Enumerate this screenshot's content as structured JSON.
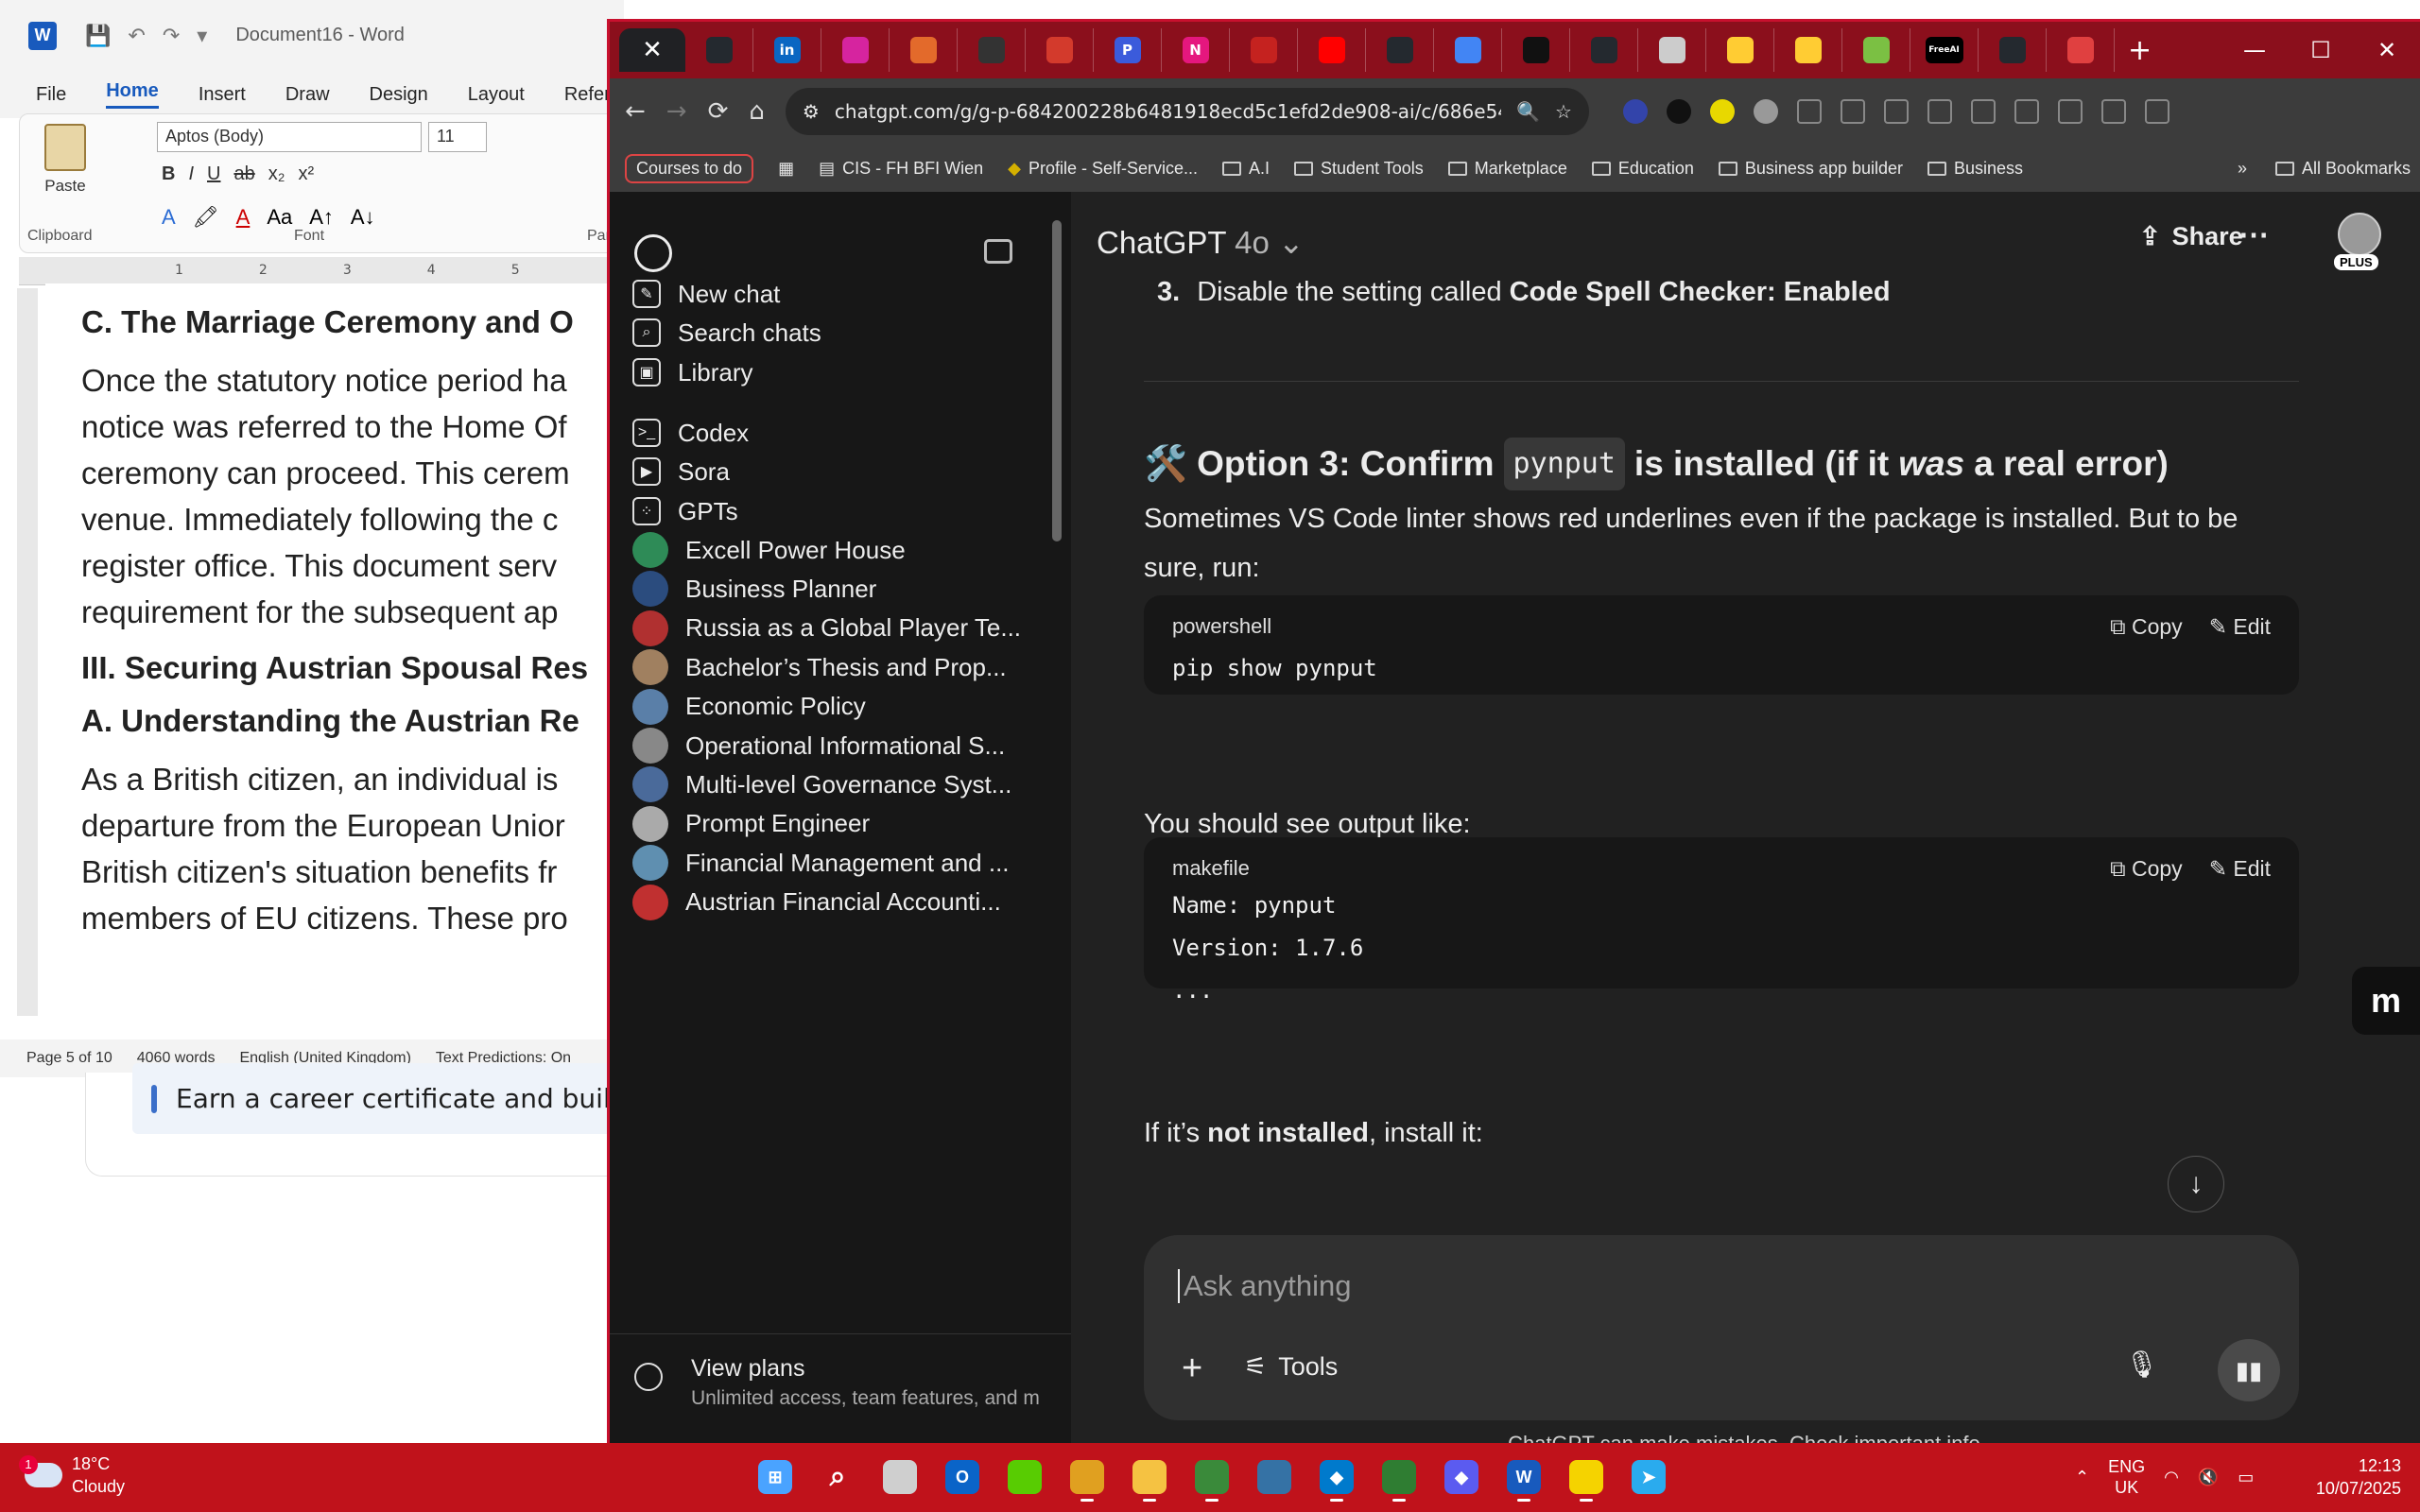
{
  "word": {
    "title": "Document16 - Word",
    "app_logo": "W",
    "quick_access": [
      "💾",
      "↶",
      "↷",
      "▾"
    ],
    "menu": [
      "File",
      "Home",
      "Insert",
      "Draw",
      "Design",
      "Layout",
      "References"
    ],
    "active_menu": "Home",
    "ribbon": {
      "paste_label": "Paste",
      "font_name": "Aptos (Body)",
      "font_size": "11",
      "format_buttons": [
        "B",
        "I",
        "U",
        "ab",
        "x₂",
        "x²"
      ],
      "format_buttons_2": [
        "A",
        "🖍",
        "A",
        "Aa",
        "A↑",
        "A↓"
      ],
      "clipboard_label": "Clipboard",
      "font_label": "Font",
      "paragraph_label": "Parag"
    },
    "ruler_marks": [
      "1",
      "2",
      "3",
      "4",
      "5"
    ],
    "document": {
      "heading1": "C. The Marriage Ceremony and O",
      "para1": [
        "Once the statutory notice period ha",
        "notice was referred to the Home Of",
        "ceremony can proceed. This cerem",
        "venue. Immediately following the c",
        "register office. This document serv",
        "requirement for the subsequent ap"
      ],
      "heading2": "III. Securing Austrian Spousal Res",
      "heading3": "A. Understanding the Austrian Re",
      "para2": [
        "As a British citizen, an individual is",
        "departure from the European Unior",
        "British citizen's situation benefits fr",
        "members of EU citizens. These pro"
      ]
    },
    "status": {
      "page": "Page 5 of 10",
      "words": "4060 words",
      "language": "English (United Kingdom)",
      "predictions": "Text Predictions: On"
    },
    "behind_card_text": "Earn a career certificate and build"
  },
  "chrome": {
    "tab_close": "✕",
    "tab_favicons": [
      {
        "name": "github",
        "label": "",
        "color": "#24292f"
      },
      {
        "name": "linkedin",
        "label": "in",
        "color": "#0a66c2"
      },
      {
        "name": "instagram",
        "label": "",
        "color": "#d6249f"
      },
      {
        "name": "site",
        "label": "",
        "color": "#e36a2b"
      },
      {
        "name": "site",
        "label": "",
        "color": "#333333"
      },
      {
        "name": "site",
        "label": "",
        "color": "#d33a2c"
      },
      {
        "name": "site",
        "label": "P",
        "color": "#3b5bdb"
      },
      {
        "name": "site",
        "label": "N",
        "color": "#e5177e"
      },
      {
        "name": "gmail",
        "label": "",
        "color": "#c5221f"
      },
      {
        "name": "youtube",
        "label": "",
        "color": "#ff0000"
      },
      {
        "name": "github",
        "label": "",
        "color": "#24292f"
      },
      {
        "name": "docs",
        "label": "",
        "color": "#4285f4"
      },
      {
        "name": "chatgpt",
        "label": "",
        "color": "#111111"
      },
      {
        "name": "github",
        "label": "",
        "color": "#24292f"
      },
      {
        "name": "site",
        "label": "",
        "color": "#cccccc"
      },
      {
        "name": "huggingface",
        "label": "",
        "color": "#ffcc33"
      },
      {
        "name": "huggingface",
        "label": "",
        "color": "#ffcc33"
      },
      {
        "name": "site",
        "label": "",
        "color": "#7bc043"
      },
      {
        "name": "site",
        "label": "FreeAI",
        "color": "#000000"
      },
      {
        "name": "github",
        "label": "",
        "color": "#24292f"
      },
      {
        "name": "site",
        "label": "",
        "color": "#e04040"
      }
    ],
    "new_tab": "+",
    "window_controls": [
      "—",
      "☐",
      "✕"
    ],
    "nav": {
      "back": "←",
      "forward": "→",
      "reload": "⟳",
      "home": "⌂"
    },
    "url": "chatgpt.com/g/g-p-684200228b6481918ecd5c1efd2de908-ai/c/686e54...",
    "omnibox_icons": [
      "🔍",
      "☆"
    ],
    "extension_colors": [
      "#3344aa",
      "#111111",
      "#e8d800",
      "#999999",
      "#888888",
      "#888888",
      "#888888",
      "#888888",
      "#888888",
      "#888888",
      "#888888",
      "#888888",
      "#888888"
    ],
    "bookmarks": [
      {
        "label": "Courses to do",
        "type": "tag"
      },
      {
        "label": "CIS - FH BFI Wien",
        "type": "page"
      },
      {
        "label": "Profile - Self-Service...",
        "type": "page"
      },
      {
        "label": "A.I",
        "type": "folder"
      },
      {
        "label": "Student Tools",
        "type": "folder"
      },
      {
        "label": "Marketplace",
        "type": "folder"
      },
      {
        "label": "Education",
        "type": "folder"
      },
      {
        "label": "Business app builder",
        "type": "folder"
      },
      {
        "label": "Business",
        "type": "folder"
      }
    ],
    "bookmarks_more": "»",
    "all_bookmarks": "All Bookmarks"
  },
  "sidebar": {
    "nav": [
      {
        "label": "New chat",
        "icon": "edit-icon",
        "glyph": "✎"
      },
      {
        "label": "Search chats",
        "icon": "search-icon",
        "glyph": "⌕"
      },
      {
        "label": "Library",
        "icon": "library-icon",
        "glyph": "▣"
      },
      {
        "label": "Codex",
        "icon": "codex-icon",
        "glyph": ">_"
      },
      {
        "label": "Sora",
        "icon": "sora-icon",
        "glyph": "▶"
      },
      {
        "label": "GPTs",
        "icon": "gpts-icon",
        "glyph": "⁘"
      }
    ],
    "gpts": [
      {
        "label": "Excell Power House",
        "color": "#2e8b57"
      },
      {
        "label": "Business Planner",
        "color": "#2b4c7e"
      },
      {
        "label": "Russia as a Global Player Te...",
        "color": "#b03030"
      },
      {
        "label": "Bachelor’s Thesis and Prop...",
        "color": "#a08060"
      },
      {
        "label": "Economic Policy",
        "color": "#5a7fa8"
      },
      {
        "label": "Operational Informational S...",
        "color": "#888888"
      },
      {
        "label": "Multi-level Governance Syst...",
        "color": "#4a6a9a"
      },
      {
        "label": "Prompt Engineer",
        "color": "#aaaaaa"
      },
      {
        "label": "Financial Management and ...",
        "color": "#5f8fb0"
      },
      {
        "label": "Austrian Financial Accounti...",
        "color": "#c03030"
      }
    ],
    "plans_title": "View plans",
    "plans_sub": "Unlimited access, team features, and m"
  },
  "main": {
    "model": "ChatGPT",
    "model_version": "4o",
    "share_label": "Share",
    "more_label": "⋯",
    "plus_badge": "PLUS",
    "step_number": "3.",
    "step_text": "Disable the setting called ",
    "step_bold": "Code Spell Checker: Enabled",
    "option_emoji": "🛠️",
    "option_pre": "Option 3: Confirm",
    "option_code": "pynput",
    "option_mid": "is installed (if it",
    "option_em": "was",
    "option_post": "a real error)",
    "para1": "Sometimes VS Code linter shows red underlines even if the package is installed. But to be sure, run:",
    "code1": {
      "lang": "powershell",
      "code": "pip show pynput"
    },
    "copy_label": "Copy",
    "edit_label": "Edit",
    "para2": "You should see output like:",
    "code2": {
      "lang": "makefile",
      "code": "Name: pynput\nVersion: 1.7.6\n..."
    },
    "para3_pre": "If it’s ",
    "para3_bold": "not installed",
    "para3_post": ", install it:",
    "scroll_down": "↓",
    "composer_placeholder": "Ask anything",
    "tools_label": "Tools",
    "disclaimer": "ChatGPT can make mistakes. Check important info."
  },
  "float_button": "m",
  "taskbar": {
    "weather_temp": "18°C",
    "weather_desc": "Cloudy",
    "weather_badge": "1",
    "apps": [
      {
        "name": "start",
        "color": "#4aa3ff",
        "label": "⊞"
      },
      {
        "name": "search",
        "color": "transparent",
        "label": "⌕"
      },
      {
        "name": "task-view",
        "color": "#cfcfcf",
        "label": ""
      },
      {
        "name": "outlook",
        "color": "#0a64c8",
        "label": "O"
      },
      {
        "name": "duolingo",
        "color": "#58cc02",
        "label": ""
      },
      {
        "name": "chrome",
        "color": "#e0a020",
        "label": ""
      },
      {
        "name": "file-explorer",
        "color": "#f5c242",
        "label": ""
      },
      {
        "name": "chrome-profile",
        "color": "#3a8a3a",
        "label": ""
      },
      {
        "name": "python",
        "color": "#3572a5",
        "label": ""
      },
      {
        "name": "vscode",
        "color": "#007acc",
        "label": "◆"
      },
      {
        "name": "chrome-2",
        "color": "#2f7d32",
        "label": ""
      },
      {
        "name": "app",
        "color": "#5b5bf0",
        "label": "◆"
      },
      {
        "name": "word",
        "color": "#185abd",
        "label": "W"
      },
      {
        "name": "app-yellow",
        "color": "#f5d300",
        "label": ""
      },
      {
        "name": "telegram",
        "color": "#2aabee",
        "label": "➤"
      }
    ],
    "lang_top": "ENG",
    "lang_bottom": "UK",
    "time": "12:13",
    "date": "10/07/2025"
  }
}
